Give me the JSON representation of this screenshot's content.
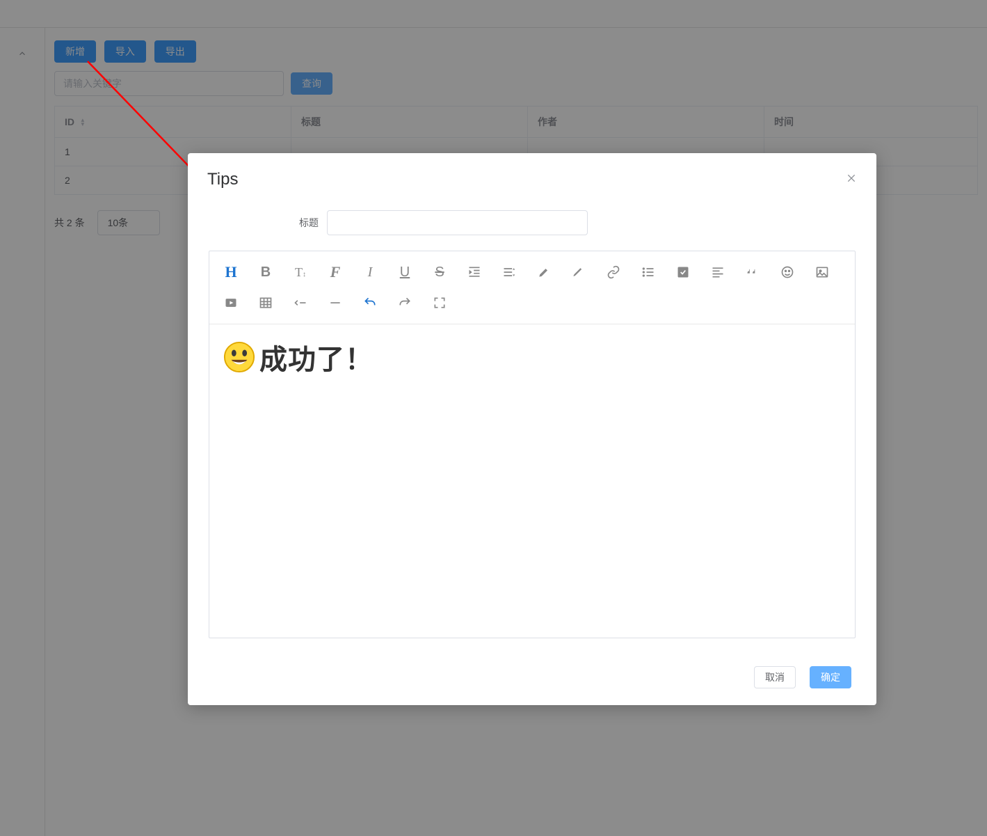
{
  "toolbar_buttons": {
    "add": "新增",
    "import": "导入",
    "export": "导出"
  },
  "search": {
    "placeholder": "请输入关键字",
    "query_btn": "查询"
  },
  "table": {
    "headers": {
      "id": "ID",
      "title": "标题",
      "author": "作者",
      "time": "时间"
    },
    "rows": [
      {
        "id": "1"
      },
      {
        "id": "2"
      }
    ]
  },
  "pager": {
    "total_text": "共 2 条",
    "pagesize_text": "10条"
  },
  "dialog": {
    "title": "Tips",
    "form_label_title": "标题",
    "editor_text": "成功了！",
    "cancel": "取消",
    "confirm": "确定"
  },
  "editor_toolbar": {
    "heading": "H",
    "bold": "B",
    "fontsize": "T",
    "fontfamily": "F",
    "italic": "I",
    "underline": "U",
    "strike": "S"
  }
}
